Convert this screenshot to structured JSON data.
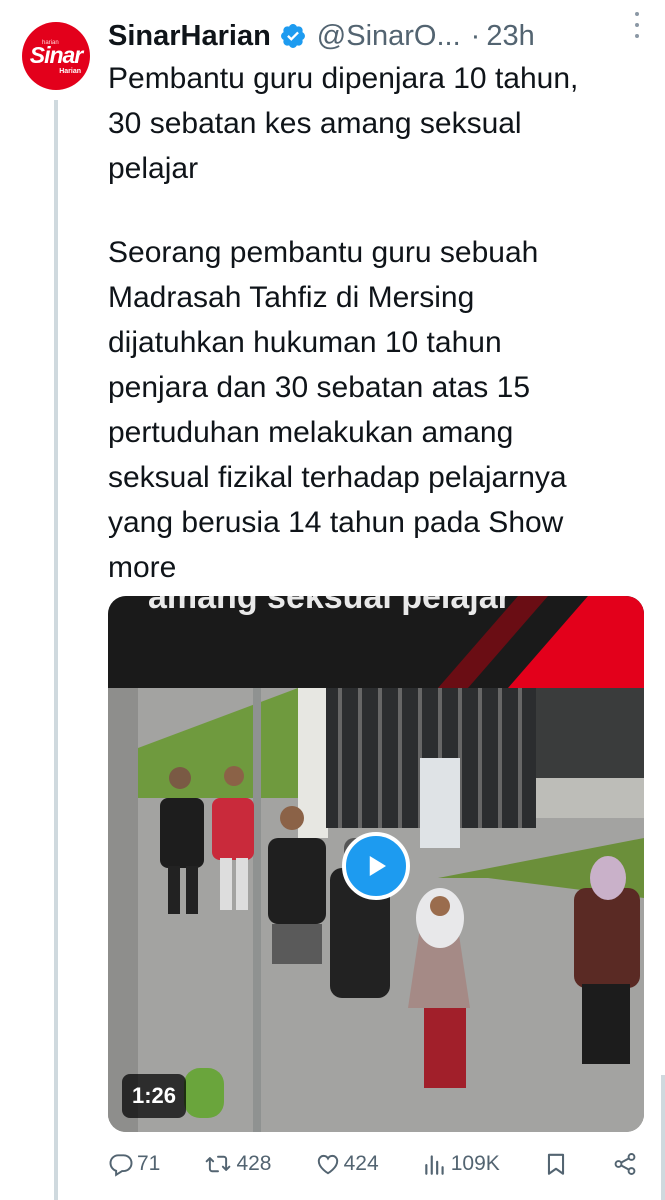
{
  "tweet": {
    "display_name": "SinarHarian",
    "handle": "@SinarO...",
    "separator": "·",
    "time": "23h",
    "avatar": {
      "small_text": "harian",
      "main_text": "Sinar",
      "sub_text": "Harian",
      "color": "#e3001b"
    },
    "verified_icon": "verified-badge-icon",
    "headline_lines": [
      "Pembantu guru dipenjara 10 tahun,",
      "30 sebatan kes amang seksual",
      "pelajar"
    ],
    "body_lines": [
      "Seorang pembantu guru sebuah",
      "Madrasah Tahfiz di Mersing",
      "dijatuhkan hukuman 10 tahun",
      "penjara dan 30 sebatan atas 15",
      "pertuduhan melakukan amang",
      "seksual fizikal terhadap pelajarnya",
      "yang berusia 14 tahun pada Show",
      "more"
    ]
  },
  "media": {
    "banner_text": "amang seksual pelajar",
    "duration": "1:26",
    "play_icon": "play-icon",
    "accent_color": "#1d9bf0",
    "banner_accent": "#e3001b"
  },
  "actions": {
    "replies": "71",
    "reposts": "428",
    "likes": "424",
    "views": "109K"
  }
}
